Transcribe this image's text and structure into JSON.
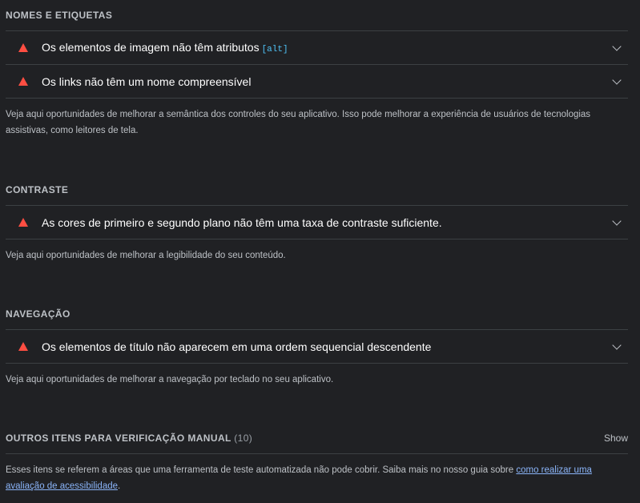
{
  "groups": [
    {
      "title": "NOMES E ETIQUETAS",
      "audits": [
        {
          "title": "Os elementos de imagem não têm atributos",
          "code": "[alt]"
        },
        {
          "title": "Os links não têm um nome compreensível",
          "code": ""
        }
      ],
      "description": "Veja aqui oportunidades de melhorar a semântica dos controles do seu aplicativo. Isso pode melhorar a experiência de usuários de tecnologias assistivas, como leitores de tela."
    },
    {
      "title": "CONTRASTE",
      "audits": [
        {
          "title": "As cores de primeiro e segundo plano não têm uma taxa de contraste suficiente.",
          "code": ""
        }
      ],
      "description": "Veja aqui oportunidades de melhorar a legibilidade do seu conteúdo."
    },
    {
      "title": "NAVEGAÇÃO",
      "audits": [
        {
          "title": "Os elementos de título não aparecem em uma ordem sequencial descendente",
          "code": ""
        }
      ],
      "description": "Veja aqui oportunidades de melhorar a navegação por teclado no seu aplicativo."
    }
  ],
  "manual": {
    "title": "OUTROS ITENS PARA VERIFICAÇÃO MANUAL",
    "count": "(10)",
    "show_label": "Show",
    "description": "Esses itens se referem a áreas que uma ferramenta de teste automatizada não pode cobrir. Saiba mais no nosso guia sobre",
    "link_text": "como realizar uma avaliação de acessibilidade",
    "suffix": "."
  },
  "icons": {
    "fail": "fail-triangle-icon",
    "expand": "chevron-down-icon"
  },
  "colors": {
    "background": "#202124",
    "fail": "#ff4e42",
    "link": "#8ab4f8",
    "code": "#4fc3f7"
  }
}
